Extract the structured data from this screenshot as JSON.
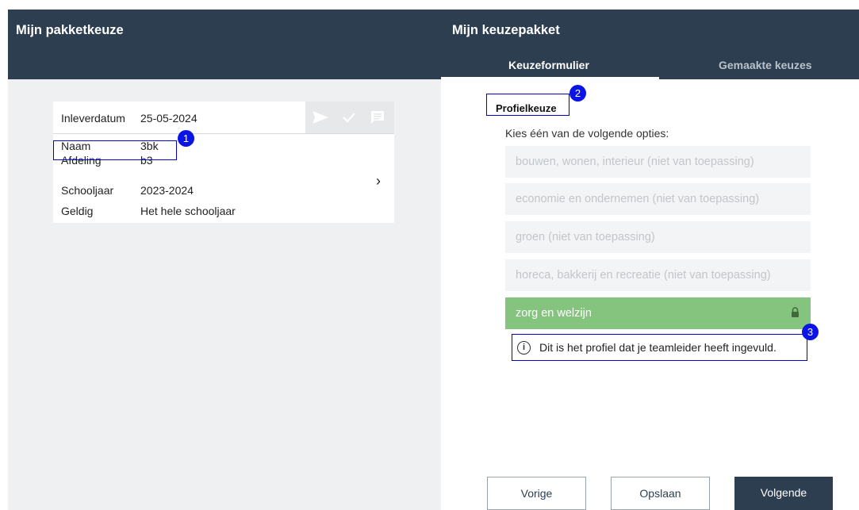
{
  "left": {
    "title": "Mijn pakketkeuze",
    "card": {
      "header_label": "Inleverdatum",
      "header_value": "25-05-2024",
      "rows": [
        {
          "label": "Naam",
          "value": "3bk"
        },
        {
          "label": "Afdeling",
          "value": "b3"
        },
        {
          "label": "Schooljaar",
          "value": "2023-2024"
        },
        {
          "label": "Geldig",
          "value": "Het hele schooljaar"
        }
      ],
      "action_icons": [
        "send-icon",
        "check-icon",
        "comment-icon"
      ],
      "chevron": "›"
    }
  },
  "right": {
    "title": "Mijn keuzepakket",
    "tabs": [
      {
        "label": "Keuzeformulier",
        "active": true
      },
      {
        "label": "Gemaakte keuzes",
        "active": false
      }
    ],
    "section_title": "Profielkeuze",
    "prompt": "Kies één van de volgende opties:",
    "options": [
      {
        "label": "bouwen, wonen, interieur (niet van toepassing)",
        "selected": false
      },
      {
        "label": "economie en ondernemen (niet van toepassing)",
        "selected": false
      },
      {
        "label": "groen (niet van toepassing)",
        "selected": false
      },
      {
        "label": "horeca, bakkerij en recreatie (niet van toepassing)",
        "selected": false
      },
      {
        "label": "zorg en welzijn",
        "selected": true,
        "locked": true
      }
    ],
    "info_icon": "i",
    "info_text": "Dit is het profiel dat je teamleider heeft ingevuld.",
    "buttons": {
      "prev": "Vorige",
      "save": "Opslaan",
      "next": "Volgende"
    }
  },
  "annotations": {
    "badge1": "1",
    "badge2": "2",
    "badge3": "3"
  },
  "colors": {
    "header_bg": "#2d3e50",
    "left_bg": "#eef0f2",
    "selected_option": "#85c47f",
    "annotation_blue": "#0a14e6"
  }
}
